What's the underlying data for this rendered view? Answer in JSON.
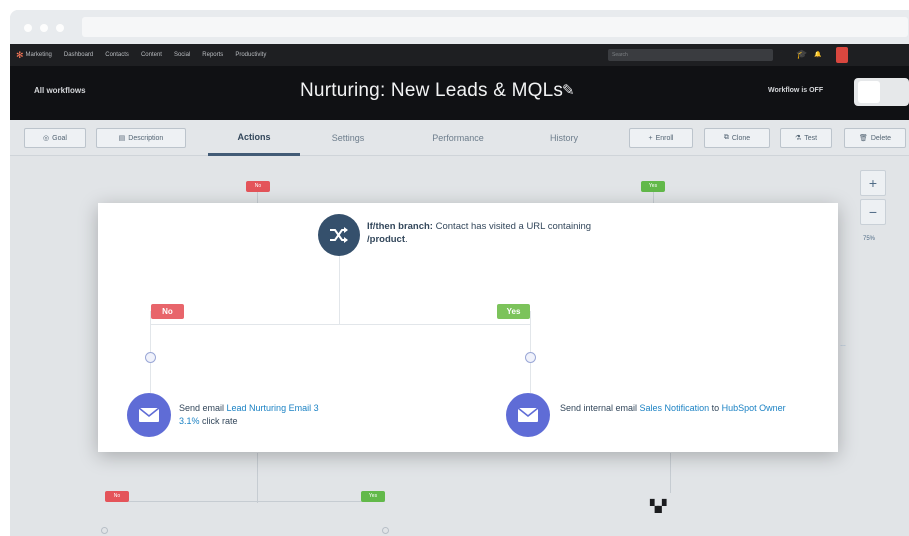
{
  "nav": {
    "items": [
      "Marketing",
      "Dashboard",
      "Contacts",
      "Content",
      "Social",
      "Reports",
      "Productivity"
    ],
    "search_placeholder": "Search"
  },
  "header": {
    "back_link": "All workflows",
    "title": "Nurturing: New Leads & MQLs",
    "status": "Workflow is OFF"
  },
  "toolbar": {
    "goal": "Goal",
    "description": "Description",
    "tabs": [
      "Actions",
      "Settings",
      "Performance",
      "History"
    ],
    "enroll": "Enroll",
    "clone": "Clone",
    "test": "Test",
    "delete": "Delete"
  },
  "canvas": {
    "no_label": "No",
    "yes_label": "Yes",
    "zoom_in": "+",
    "zoom_out": "−",
    "zoom_level": "75%"
  },
  "card": {
    "branch_title": "If/then branch:",
    "branch_text": " Contact has visited a URL containing ",
    "branch_value": "/product",
    "branch_end": ".",
    "no_label": "No",
    "yes_label": "Yes",
    "left": {
      "prefix": "Send email ",
      "email_name": "Lead Nurturing Email 3",
      "click_rate": "3.1%",
      "click_rate_suffix": " click rate"
    },
    "right": {
      "prefix": "Send internal email ",
      "email_name": "Sales Notification",
      "middle": " to ",
      "recipient": "HubSpot Owner"
    }
  },
  "colors": {
    "accent_orange": "#ff7a59",
    "branch_icon": "#35506c",
    "email_icon": "#5f6cd6",
    "no_badge": "#e8656b",
    "yes_badge": "#7cc35b",
    "link": "#1b82c4"
  },
  "icons": [
    "sprocket-icon",
    "graduation-cap-icon",
    "bell-icon",
    "shuffle-icon",
    "envelope-icon",
    "pencil-icon"
  ]
}
